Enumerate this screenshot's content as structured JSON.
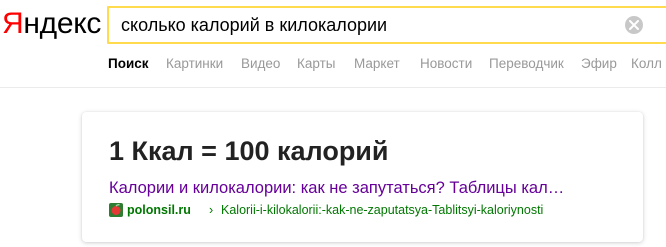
{
  "logo": {
    "first_letter": "Я",
    "rest": "ндекс"
  },
  "search": {
    "query": "сколько калорий в килокалории"
  },
  "tabs": [
    {
      "label": "Поиск",
      "active": true
    },
    {
      "label": "Картинки"
    },
    {
      "label": "Видео"
    },
    {
      "label": "Карты"
    },
    {
      "label": "Маркет"
    },
    {
      "label": "Новости"
    },
    {
      "label": "Переводчик"
    },
    {
      "label": "Эфир"
    },
    {
      "label": "Колл"
    }
  ],
  "card": {
    "answer": "1 Ккал = 100 калорий",
    "result_title": "Калории и килокалории: как не запутаться? Таблицы кал…",
    "domain": "polonsil.ru",
    "separator": "›",
    "path": "Kalorii-i-kilokalorii:-kak-ne-zaputatsya-Tablitsyi-kaloriynosti"
  },
  "colors": {
    "logo_red": "#ff0000",
    "search_border": "#ffdb4d",
    "visited_link": "#660099",
    "url_green": "#007700",
    "tab_gray": "#999999"
  }
}
